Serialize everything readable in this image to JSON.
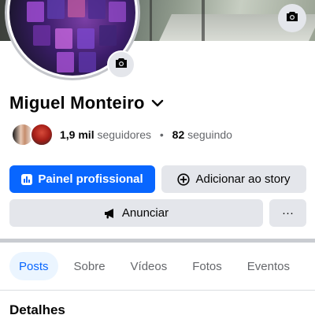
{
  "profile": {
    "name": "Miguel Monteiro",
    "followers_count": "1,9 mil",
    "followers_label": "seguidores",
    "separator": "•",
    "following_count": "82",
    "following_label": "seguindo"
  },
  "icons": {
    "cover_camera": "camera-icon",
    "avatar_camera": "camera-icon",
    "name_dropdown": "chevron-down-icon",
    "dashboard": "dashboard-icon",
    "add_story": "plus-circle-icon",
    "advertise": "megaphone-icon",
    "more": "more-dots-icon"
  },
  "actions": {
    "professional_dashboard": "Painel profissional",
    "add_to_story": "Adicionar ao story",
    "advertise": "Anunciar",
    "more": "···"
  },
  "tabs": [
    {
      "label": "Posts",
      "active": true
    },
    {
      "label": "Sobre",
      "active": false
    },
    {
      "label": "Vídeos",
      "active": false
    },
    {
      "label": "Fotos",
      "active": false
    },
    {
      "label": "Eventos",
      "active": false
    }
  ],
  "sections": {
    "details_title": "Detalhes"
  },
  "colors": {
    "primary": "#0866ff",
    "secondary_button": "#e4e6eb",
    "active_tab_bg": "#ebf5ff",
    "muted_text": "#65676b"
  }
}
